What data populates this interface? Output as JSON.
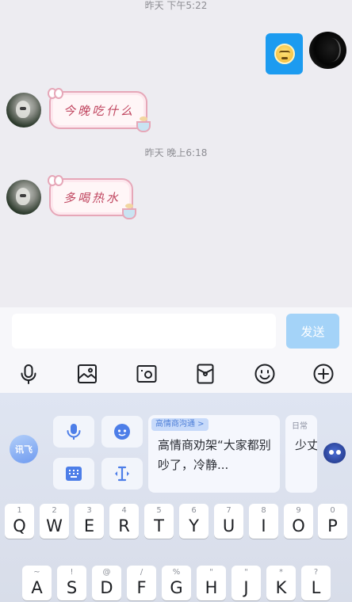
{
  "chat": {
    "timestamps": [
      "昨天 下午5:22",
      "昨天 晚上6:18"
    ],
    "messages": [
      {
        "from": "other",
        "text": "今晚吃什么"
      },
      {
        "from": "other",
        "text": "多喝热水"
      }
    ]
  },
  "input": {
    "value": "",
    "send_label": "发送"
  },
  "toolbar": {
    "icons": [
      "microphone-icon",
      "image-icon",
      "camera-icon",
      "red-packet-icon",
      "emoji-icon",
      "plus-icon"
    ]
  },
  "ime": {
    "logo_label": "讯飞",
    "quick_icons": [
      "voice-icon",
      "assistant-icon",
      "keyboard-icon",
      "cursor-icon"
    ],
    "cards": [
      {
        "tag": "高情商沟通 >",
        "text": "高情商劝架“大家都别吵了，冷静..."
      },
      {
        "tag": "日常",
        "text": "少丈成为"
      }
    ],
    "row1": [
      {
        "sub": "1",
        "key": "Q"
      },
      {
        "sub": "2",
        "key": "W"
      },
      {
        "sub": "3",
        "key": "E"
      },
      {
        "sub": "4",
        "key": "R"
      },
      {
        "sub": "5",
        "key": "T"
      },
      {
        "sub": "6",
        "key": "Y"
      },
      {
        "sub": "7",
        "key": "U"
      },
      {
        "sub": "8",
        "key": "I"
      },
      {
        "sub": "9",
        "key": "O"
      },
      {
        "sub": "0",
        "key": "P"
      }
    ],
    "row2": [
      {
        "sub": "~",
        "key": "A"
      },
      {
        "sub": "!",
        "key": "S"
      },
      {
        "sub": "@",
        "key": "D"
      },
      {
        "sub": "/",
        "key": "F"
      },
      {
        "sub": "%",
        "key": "G"
      },
      {
        "sub": "\"",
        "key": "H"
      },
      {
        "sub": "\"",
        "key": "J"
      },
      {
        "sub": "*",
        "key": "K"
      },
      {
        "sub": "?",
        "key": "L"
      }
    ]
  },
  "colors": {
    "chat_bg": "#edecf1",
    "send_disabled": "#a4d3f8",
    "self_bubble": "#1c9bf0",
    "sticker_text": "#c0455f"
  }
}
